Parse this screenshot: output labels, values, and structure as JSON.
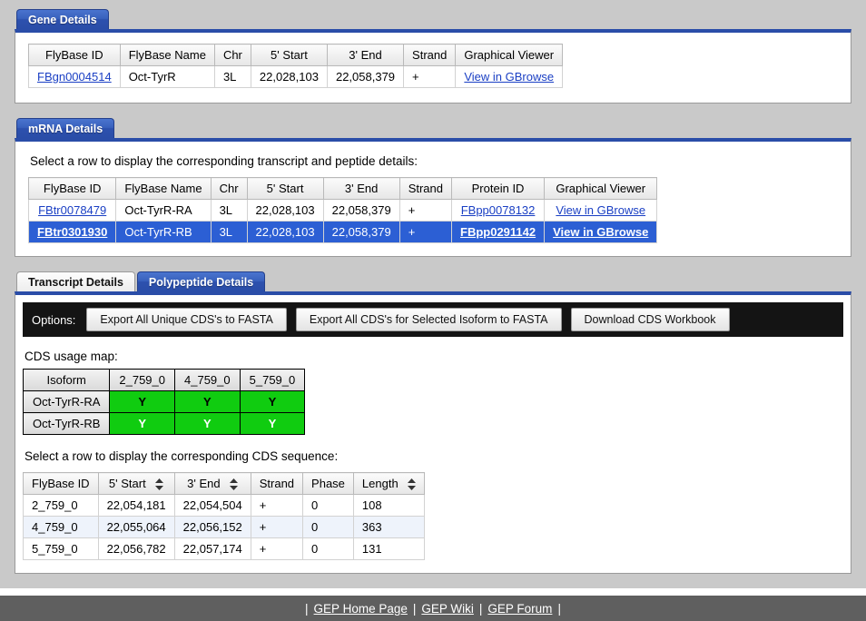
{
  "gene_section": {
    "tab_label": "Gene Details",
    "table": {
      "headers": [
        "FlyBase ID",
        "FlyBase Name",
        "Chr",
        "5' Start",
        "3' End",
        "Strand",
        "Graphical Viewer"
      ],
      "rows": [
        {
          "flybase_id": "FBgn0004514",
          "flybase_name": "Oct-TyrR",
          "chr": "3L",
          "start": "22,028,103",
          "end": "22,058,379",
          "strand": "+",
          "viewer": "View in GBrowse"
        }
      ]
    }
  },
  "mrna_section": {
    "tab_label": "mRNA Details",
    "instruction": "Select a row to display the corresponding transcript and peptide details:",
    "table": {
      "headers": [
        "FlyBase ID",
        "FlyBase Name",
        "Chr",
        "5' Start",
        "3' End",
        "Strand",
        "Protein ID",
        "Graphical Viewer"
      ],
      "rows": [
        {
          "flybase_id": "FBtr0078479",
          "flybase_name": "Oct-TyrR-RA",
          "chr": "3L",
          "start": "22,028,103",
          "end": "22,058,379",
          "strand": "+",
          "protein_id": "FBpp0078132",
          "viewer": "View in GBrowse",
          "selected": false
        },
        {
          "flybase_id": "FBtr0301930",
          "flybase_name": "Oct-TyrR-RB",
          "chr": "3L",
          "start": "22,028,103",
          "end": "22,058,379",
          "strand": "+",
          "protein_id": "FBpp0291142",
          "viewer": "View in GBrowse",
          "selected": true
        }
      ]
    }
  },
  "detail_section": {
    "tabs": [
      {
        "label": "Transcript Details",
        "active": false
      },
      {
        "label": "Polypeptide Details",
        "active": true
      }
    ],
    "options": {
      "label": "Options:",
      "buttons": [
        "Export All Unique CDS's to FASTA",
        "Export All CDS's for Selected Isoform to FASTA",
        "Download CDS Workbook"
      ]
    },
    "usage_map": {
      "title": "CDS usage map:",
      "headers": [
        "Isoform",
        "2_759_0",
        "4_759_0",
        "5_759_0"
      ],
      "rows": [
        {
          "isoform": "Oct-TyrR-RA",
          "cells": [
            "Y",
            "Y",
            "Y"
          ],
          "selected": false
        },
        {
          "isoform": "Oct-TyrR-RB",
          "cells": [
            "Y",
            "Y",
            "Y"
          ],
          "selected": true
        }
      ]
    },
    "cds_table": {
      "instruction": "Select a row to display the corresponding CDS sequence:",
      "headers": [
        {
          "label": "FlyBase ID",
          "sortable": false
        },
        {
          "label": "5' Start",
          "sortable": true
        },
        {
          "label": "3' End",
          "sortable": true
        },
        {
          "label": "Strand",
          "sortable": false
        },
        {
          "label": "Phase",
          "sortable": false
        },
        {
          "label": "Length",
          "sortable": true
        }
      ],
      "rows": [
        {
          "flybase_id": "2_759_0",
          "start": "22,054,181",
          "end": "22,054,504",
          "strand": "+",
          "phase": "0",
          "length": "108"
        },
        {
          "flybase_id": "4_759_0",
          "start": "22,055,064",
          "end": "22,056,152",
          "strand": "+",
          "phase": "0",
          "length": "363"
        },
        {
          "flybase_id": "5_759_0",
          "start": "22,056,782",
          "end": "22,057,174",
          "strand": "+",
          "phase": "0",
          "length": "131"
        }
      ]
    }
  },
  "footer": {
    "left_bar": "|",
    "links": [
      "GEP Home Page",
      "GEP Wiki",
      "GEP Forum"
    ],
    "separator": "|"
  },
  "colors": {
    "accent_blue": "#2a4da8",
    "selected_row": "#2c5fd4",
    "link": "#1a3fc4",
    "usage_green": "#10cc10",
    "page_bg": "#c9c9c9",
    "options_bar": "#141414",
    "footer_bg": "#5f5f5f"
  }
}
